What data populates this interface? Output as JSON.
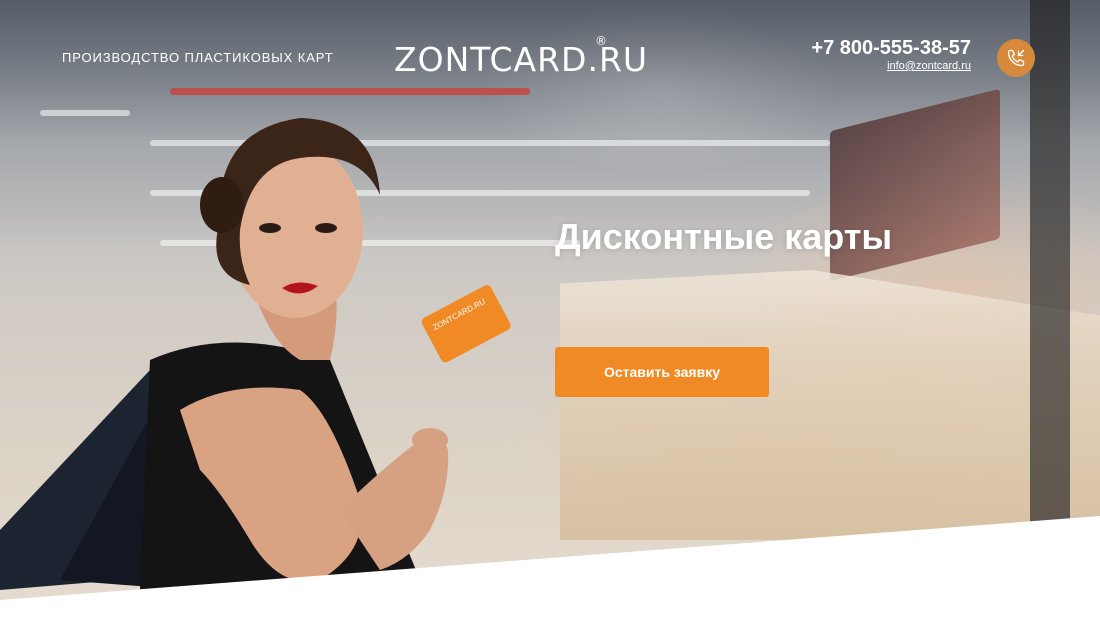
{
  "header": {
    "tagline": "ПРОИЗВОДСТВО ПЛАСТИКОВЫХ КАРТ",
    "logo_text": "ZONTCARD.RU",
    "logo_mark": "®",
    "phone": "+7 800-555-38-57",
    "email": "info@zontcard.ru"
  },
  "hero": {
    "title": "Дисконтные карты",
    "cta_label": "Оставить заявку",
    "card_text": "ZONTCARD.RU"
  },
  "colors": {
    "accent": "#f08a24",
    "call_button": "#d88a3c",
    "text": "#ffffff"
  },
  "icons": {
    "call": "phone-incoming-icon"
  }
}
